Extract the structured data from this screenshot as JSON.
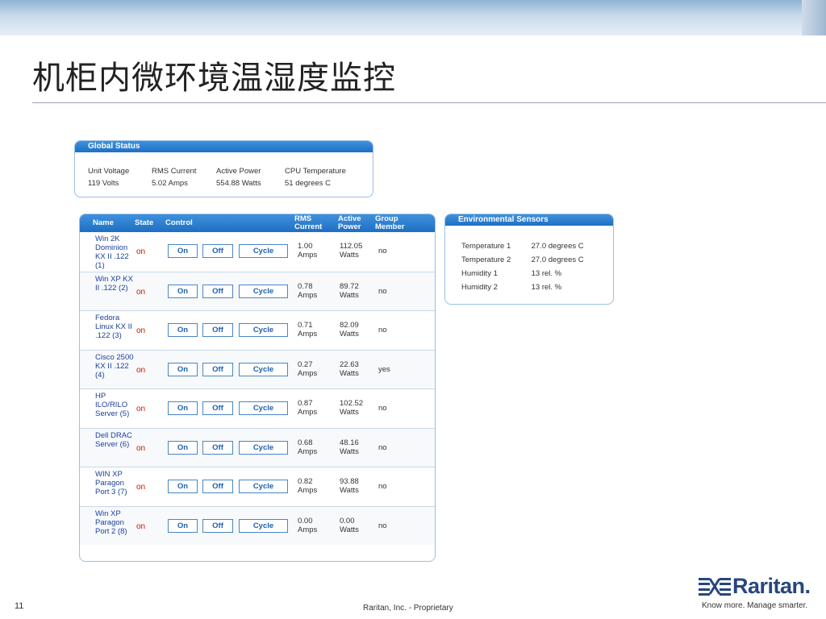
{
  "slide": {
    "title": "机柜内微环境温湿度监控",
    "page_number": "11",
    "footer": "Raritan, Inc. - Proprietary"
  },
  "logo": {
    "wordmark": "Raritan.",
    "tagline": "Know more. Manage smarter.",
    "color": "#27467f"
  },
  "global_status": {
    "header": "Global Status",
    "columns": [
      {
        "label": "Unit Voltage",
        "value": "119 Volts"
      },
      {
        "label": "RMS Current",
        "value": "5.02 Amps"
      },
      {
        "label": "Active Power",
        "value": "554.88 Watts"
      },
      {
        "label": "CPU Temperature",
        "value": "51 degrees C"
      }
    ]
  },
  "environment": {
    "header": "Environmental Sensors",
    "sensors": [
      {
        "label": "Temperature 1",
        "value": "27.0 degrees C"
      },
      {
        "label": "Temperature 2",
        "value": "27.0 degrees C"
      },
      {
        "label": "Humidity 1",
        "value": "13 rel. %"
      },
      {
        "label": "Humidity 2",
        "value": "13 rel. %"
      }
    ]
  },
  "outlets": {
    "headers": {
      "name": "Name",
      "state": "State",
      "control": "Control",
      "rms_1": "RMS",
      "rms_2": "Current",
      "power_1": "Active",
      "power_2": "Power",
      "group_1": "Group",
      "group_2": "Member"
    },
    "button_labels": {
      "on": "On",
      "off": "Off",
      "cycle": "Cycle"
    },
    "rows": [
      {
        "name": "Win 2K Dominion KX II .122 (1)",
        "state": "on",
        "rms": "1.00",
        "rms_unit": "Amps",
        "power": "112.05",
        "power_unit": "Watts",
        "group": "no"
      },
      {
        "name": "Win XP KX II .122 (2)",
        "state": "on",
        "rms": "0.78",
        "rms_unit": "Amps",
        "power": "89.72",
        "power_unit": "Watts",
        "group": "no"
      },
      {
        "name": "Fedora Linux KX II .122 (3)",
        "state": "on",
        "rms": "0.71",
        "rms_unit": "Amps",
        "power": "82.09",
        "power_unit": "Watts",
        "group": "no"
      },
      {
        "name": "Cisco 2500 KX II .122 (4)",
        "state": "on",
        "rms": "0.27",
        "rms_unit": "Amps",
        "power": "22.63",
        "power_unit": "Watts",
        "group": "yes"
      },
      {
        "name": "HP ILO/RILO Server (5)",
        "state": "on",
        "rms": "0.87",
        "rms_unit": "Amps",
        "power": "102.52",
        "power_unit": "Watts",
        "group": "no"
      },
      {
        "name": "Dell DRAC Server (6)",
        "state": "on",
        "rms": "0.68",
        "rms_unit": "Amps",
        "power": "48.16",
        "power_unit": "Watts",
        "group": "no"
      },
      {
        "name": "WIN XP Paragon Port 3 (7)",
        "state": "on",
        "rms": "0.82",
        "rms_unit": "Amps",
        "power": "93.88",
        "power_unit": "Watts",
        "group": "no"
      },
      {
        "name": "Win XP Paragon Port 2 (8)",
        "state": "on",
        "rms": "0.00",
        "rms_unit": "Amps",
        "power": "0.00",
        "power_unit": "Watts",
        "group": "no"
      }
    ]
  },
  "colors": {
    "panel_header": "#2a7fd4",
    "state_on": "#cc1100",
    "outlet_name": "#1a3fa0"
  }
}
